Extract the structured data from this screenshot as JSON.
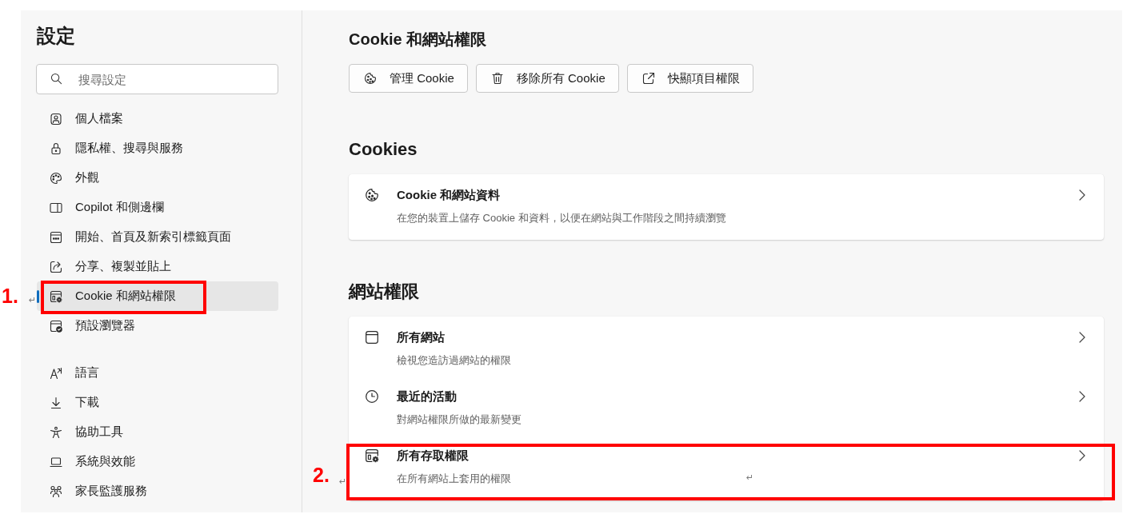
{
  "sidebar": {
    "title": "設定",
    "search": {
      "placeholder": "搜尋設定"
    },
    "groups": [
      {
        "items": [
          {
            "label": "個人檔案",
            "selected": false
          },
          {
            "label": "隱私權、搜尋與服務",
            "selected": false
          },
          {
            "label": "外觀",
            "selected": false
          },
          {
            "label": "Copilot 和側邊欄",
            "selected": false
          },
          {
            "label": "開始、首頁及新索引標籤頁面",
            "selected": false
          },
          {
            "label": "分享、複製並貼上",
            "selected": false
          },
          {
            "label": "Cookie 和網站權限",
            "selected": true
          },
          {
            "label": "預設瀏覽器",
            "selected": false
          }
        ]
      },
      {
        "items": [
          {
            "label": "語言",
            "selected": false
          },
          {
            "label": "下載",
            "selected": false
          },
          {
            "label": "協助工具",
            "selected": false
          },
          {
            "label": "系統與效能",
            "selected": false
          },
          {
            "label": "家長監護服務",
            "selected": false
          }
        ]
      }
    ]
  },
  "main": {
    "title": "Cookie 和網站權限",
    "buttons": [
      "管理 Cookie",
      "移除所有 Cookie",
      "快顯項目權限"
    ],
    "sections": [
      {
        "heading": "Cookies",
        "rows": [
          {
            "title": "Cookie 和網站資料",
            "description": "在您的裝置上儲存 Cookie 和資料，以便在網站與工作階段之間持續瀏覽"
          }
        ]
      },
      {
        "heading": "網站權限",
        "rows": [
          {
            "title": "所有網站",
            "description": "檢視您造訪過網站的權限"
          },
          {
            "title": "最近的活動",
            "description": "對網站權限所做的最新變更"
          },
          {
            "title": "所有存取權限",
            "description": "在所有網站上套用的權限"
          }
        ]
      }
    ]
  },
  "annotations": {
    "step_labels": [
      "1.",
      "2."
    ],
    "paragraph_marks": [
      "↵",
      "↵",
      "↵"
    ]
  }
}
